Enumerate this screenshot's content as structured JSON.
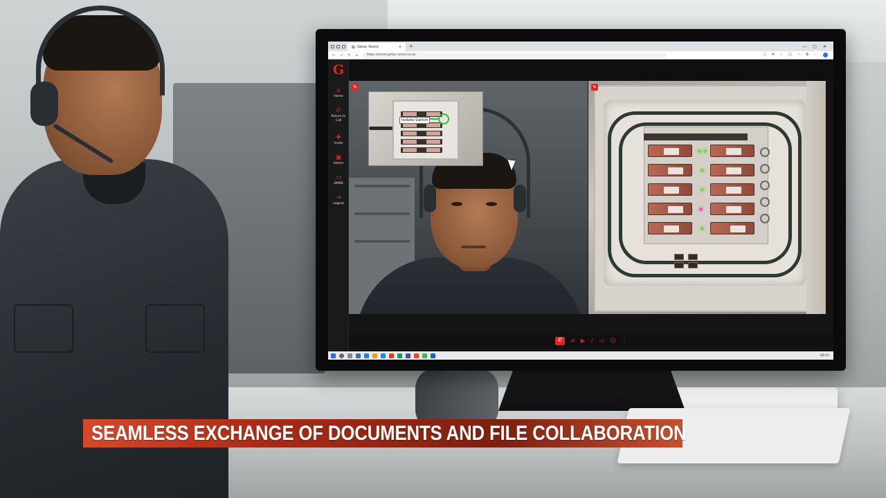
{
  "browser": {
    "tab_title": "Getac Assist",
    "tab_logo": "G",
    "tab_close": "×",
    "new_tab": "+",
    "url": "https://assist.getac-assist.co.uk",
    "window_controls": [
      "—",
      "▢",
      "✕"
    ]
  },
  "app": {
    "logo": "G",
    "brand_color": "#e0261f",
    "sidebar": {
      "items": [
        {
          "icon": "home-icon",
          "glyph": "⌂",
          "label": "Home"
        },
        {
          "icon": "phone-icon",
          "glyph": "✆",
          "label": "Return to Call"
        },
        {
          "icon": "add-user-icon",
          "glyph": "✚",
          "label": "Invite"
        },
        {
          "icon": "admin-icon",
          "glyph": "▣",
          "label": "Admin"
        },
        {
          "icon": "folder-icon",
          "glyph": "▭",
          "label": "DAMS"
        },
        {
          "icon": "logout-icon",
          "glyph": "⇥",
          "label": "Logout"
        }
      ]
    },
    "shared_image": {
      "annotation_label": "Isolate Switch",
      "marker_color": "#29c12c"
    },
    "call_toolbar": {
      "buttons": [
        {
          "icon": "end-call-icon",
          "glyph": "✆"
        },
        {
          "icon": "switch-camera-icon",
          "glyph": "⇄"
        },
        {
          "icon": "video-icon",
          "glyph": "▶"
        },
        {
          "icon": "microphone-icon",
          "glyph": "♪"
        },
        {
          "icon": "screen-share-icon",
          "glyph": "▭"
        },
        {
          "icon": "participants-icon",
          "glyph": "☺"
        },
        {
          "icon": "more-icon",
          "glyph": "⋮"
        }
      ]
    }
  },
  "taskbar": {
    "clock": "09:11"
  },
  "caption": {
    "text": "SEAMLESS EXCHANGE OF DOCUMENTS AND FILE COLLABORATION"
  }
}
